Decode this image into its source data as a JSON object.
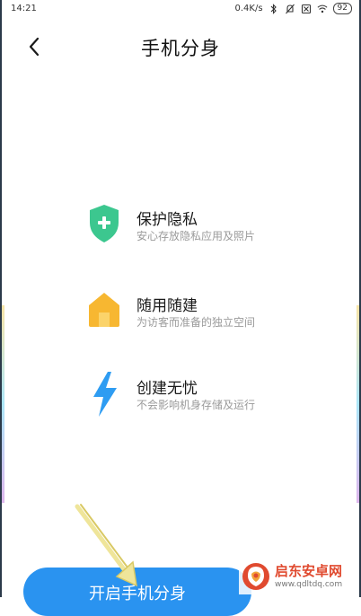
{
  "status_bar": {
    "time": "14:21",
    "net_speed": "0.4K/s",
    "battery": "92"
  },
  "header": {
    "title": "手机分身"
  },
  "features": [
    {
      "title": "保护隐私",
      "desc": "安心存放隐私应用及照片",
      "icon": "shield-plus-icon",
      "color": "#3cc78f"
    },
    {
      "title": "随用随建",
      "desc": "为访客而准备的独立空间",
      "icon": "house-icon",
      "color": "#f7b731"
    },
    {
      "title": "创建无忧",
      "desc": "不会影响机身存储及运行",
      "icon": "lightning-icon",
      "color": "#2e9cf2"
    }
  ],
  "bottom": {
    "button_label": "开启手机分身",
    "accent": "#2a93f0"
  },
  "watermark": {
    "name": "启东安卓网",
    "url": "www.qdltdq.com"
  }
}
